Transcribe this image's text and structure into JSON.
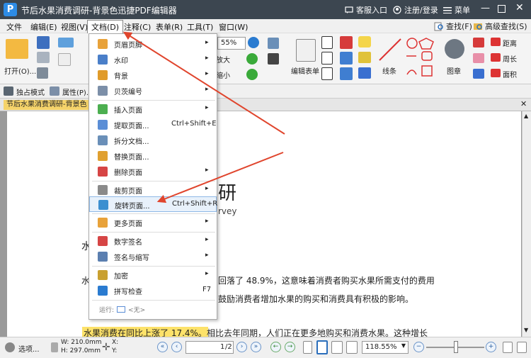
{
  "app": {
    "title": "节后水果消费调研-背景色迅捷PDF编辑器",
    "logo": "P",
    "customer_service": "客服入口",
    "login": "注册/登录",
    "menu": "菜单"
  },
  "menubar": {
    "items": [
      "文件",
      "编辑(E)",
      "视图(V)",
      "文档(D)",
      "注释(C)",
      "表单(R)",
      "工具(T)",
      "窗口(W)"
    ],
    "search": "查找(F)",
    "advanced_search": "高级查找(S)"
  },
  "ribbon": {
    "open": "打开(O)...",
    "zoom_value": "55%",
    "zoom_in": "放大",
    "zoom_out": "缩小",
    "edit_form": "编辑表单",
    "line": "线条",
    "stamp": "图章",
    "distance": "距离",
    "perimeter": "周长",
    "area": "面积",
    "exclusive_mode": "独占模式",
    "properties": "属性(P)..."
  },
  "document": {
    "tab_name": "节后水果消费调研-背景色",
    "heading_partial": "研",
    "subheading_partial": "rvey",
    "left_char_1": "水",
    "left_char_2": "水",
    "para1_line1": "回落了 48.9%，这意味着消费者购买水果所需支付的费用",
    "para1_line2": "鼓励消费者增加水果的购买和消费具有积极的影响。",
    "highlighted": "水果消费在同比上涨了 17.4%。",
    "para2": "相比去年同期，人们正在更多地购买和消费水果。这种增长"
  },
  "dropdown": {
    "items": [
      {
        "label": "页眉页脚",
        "shortcut": "",
        "arrow": "▸",
        "color": "#e8a23a"
      },
      {
        "label": "水印",
        "shortcut": "",
        "arrow": "▸",
        "color": "#4a7fc9"
      },
      {
        "label": "背景",
        "shortcut": "",
        "arrow": "▸",
        "color": "#e09b2a"
      },
      {
        "label": "贝茨编号",
        "shortcut": "",
        "arrow": "▸",
        "color": "#7c8fa8"
      },
      {
        "label": "插入页面",
        "shortcut": "",
        "arrow": "▸",
        "color": "#4caf50"
      },
      {
        "label": "提取页面...",
        "shortcut": "Ctrl+Shift+E",
        "arrow": "",
        "color": "#5b8ed6"
      },
      {
        "label": "拆分文档...",
        "shortcut": "",
        "arrow": "",
        "color": "#6a8fb8"
      },
      {
        "label": "替换页面...",
        "shortcut": "",
        "arrow": "",
        "color": "#e0a030"
      },
      {
        "label": "删除页面",
        "shortcut": "",
        "arrow": "▸",
        "color": "#d64545"
      },
      {
        "label": "裁剪页面",
        "shortcut": "",
        "arrow": "▸",
        "color": "#8a8a8a"
      },
      {
        "label": "旋转页面...",
        "shortcut": "Ctrl+Shift+R",
        "arrow": "",
        "color": "#3c8fd0"
      },
      {
        "label": "更多页面",
        "shortcut": "",
        "arrow": "▸",
        "color": "#e8a23a"
      },
      {
        "label": "数字签名",
        "shortcut": "",
        "arrow": "▸",
        "color": "#d64545"
      },
      {
        "label": "签名与缩写",
        "shortcut": "",
        "arrow": "▸",
        "color": "#5b7fb0"
      },
      {
        "label": "加密",
        "shortcut": "",
        "arrow": "▸",
        "color": "#c9a030"
      },
      {
        "label": "拼写检查",
        "shortcut": "F7",
        "arrow": "",
        "color": "#2a7bd0"
      }
    ],
    "run_label": "运行:",
    "run_value": "<无>"
  },
  "statusbar": {
    "options": "选项...",
    "width": "W: 210.0mm",
    "height": "H: 297.0mm",
    "x": "X:",
    "y": "Y:",
    "page_indicator": "1",
    "page_total": "/2",
    "zoom": "118.55%"
  },
  "colors": {
    "titlebar": "#3c4650",
    "highlight": "#fde26a",
    "annotation_arrow": "#e0452d"
  }
}
